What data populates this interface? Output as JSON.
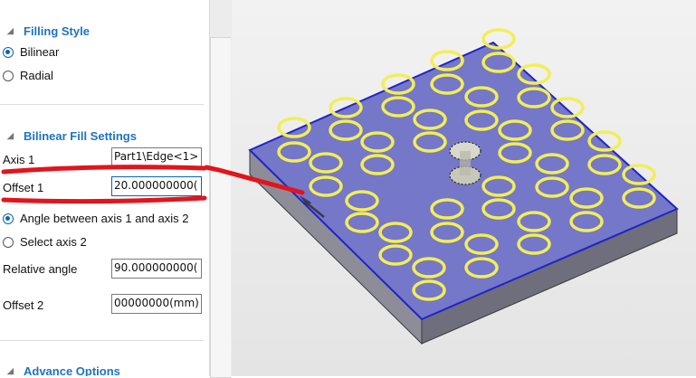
{
  "panel": {
    "filling_style": {
      "title": "Filling Style",
      "options": [
        {
          "label": "Bilinear",
          "selected": true
        },
        {
          "label": "Radial",
          "selected": false
        }
      ]
    },
    "bilinear": {
      "title": "Bilinear Fill Settings",
      "axis1_label": "Axis 1",
      "axis1_value": "Part1\\Edge<1>",
      "offset1_label": "Offset 1",
      "offset1_value": "20.000000000(",
      "axis2_options": [
        {
          "label": "Angle between axis 1 and axis 2",
          "selected": true
        },
        {
          "label": "Select axis 2",
          "selected": false
        }
      ],
      "relative_angle_label": "Relative angle",
      "relative_angle_value": "90.000000000(",
      "offset2_label": "Offset 2",
      "offset2_value": "00000000(mm)"
    },
    "advance": {
      "title": "Advance Options"
    }
  },
  "colors": {
    "accent": "#1e73be",
    "radio_selected": "#0b63b0",
    "annotation_red": "#e3141b",
    "plate_top": "#7577c8",
    "plate_edge": "#1f23c8",
    "ring": "#f2ee58"
  }
}
